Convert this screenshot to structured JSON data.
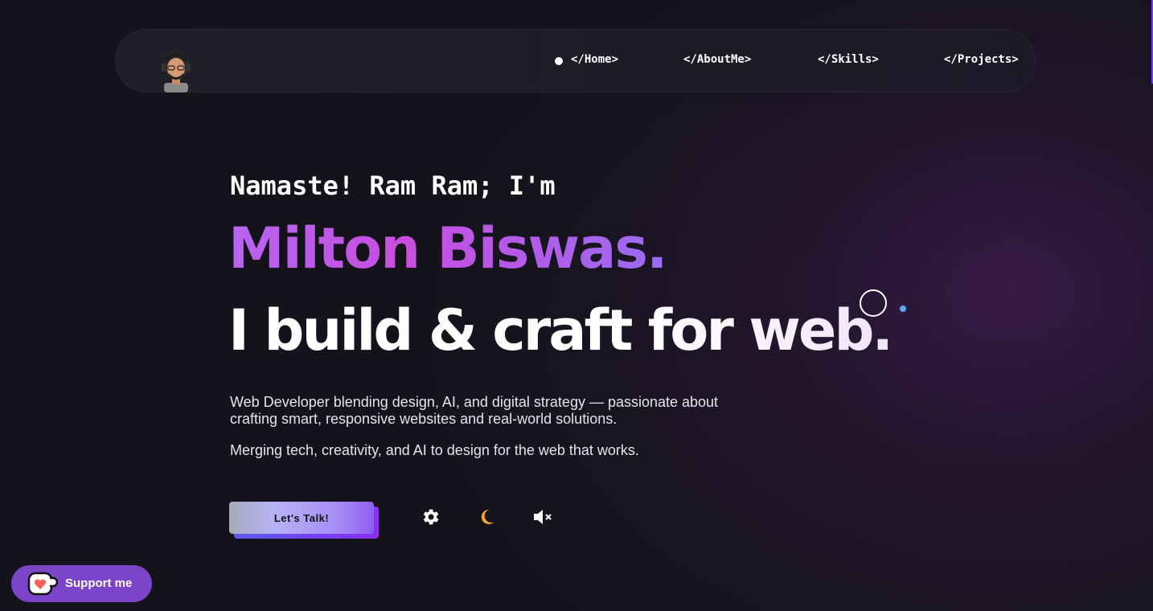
{
  "nav": {
    "avatar_icon": "avatar-icon",
    "links": [
      {
        "label": "</Home>",
        "active": true
      },
      {
        "label": "</AboutMe>"
      },
      {
        "label": "</Skills>"
      },
      {
        "label": "</Projects>"
      }
    ]
  },
  "hero": {
    "greeting": "Namaste! Ram Ram; I'm",
    "name": "Milton Biswas.",
    "tagline": "I build & craft for web.",
    "description": "Web Developer blending design, AI, and digital strategy — passionate about crafting smart, responsive websites and real-world solutions.",
    "subdescription": "Merging tech, creativity, and AI to design for the web that works."
  },
  "actions": {
    "cta_label": "Let's Talk!",
    "settings_icon": "gear-icon",
    "theme_icon": "moon-icon",
    "sound_icon": "speaker-muted-icon"
  },
  "support": {
    "label": "Support me",
    "icon": "kofi-cup-icon"
  },
  "colors": {
    "background": "#14131b",
    "accent_purple": "#7b44c9",
    "name_gradient_start": "#b565f0",
    "name_gradient_end": "#9a6cf0",
    "moon": "#f5a524",
    "cursor_dot": "#60a5fa"
  }
}
